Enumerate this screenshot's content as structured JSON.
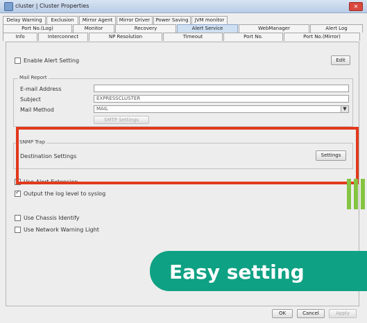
{
  "window": {
    "title": "cluster | Cluster Properties",
    "close_glyph": "✕"
  },
  "tabs": {
    "row1": [
      "Delay Warning",
      "Exclusion",
      "Mirror Agent",
      "Mirror Driver",
      "Power Saving",
      "JVM monitor"
    ],
    "row2": [
      "Port No.(Log)",
      "Monitor",
      "Recovery",
      "Alert Service",
      "WebManager",
      "Alert Log"
    ],
    "row3": [
      "Info",
      "Interconnect",
      "NP Resolution",
      "Timeout",
      "Port No.",
      "Port No.(Mirror)"
    ],
    "active": "Alert Service"
  },
  "alert": {
    "enable_label": "Enable Alert Setting",
    "enable_checked": false,
    "edit_button": "Edit"
  },
  "mail_report": {
    "legend": "Mail Report",
    "email_label": "E-mail Address",
    "email_value": "",
    "subject_label": "Subject",
    "subject_value": "EXPRESSCLUSTER",
    "method_label": "Mail Method",
    "method_value": "MAIL",
    "smtp_button": "SMTP Settings"
  },
  "snmp": {
    "legend": "SNMP Trap",
    "dest_label": "Destination Settings",
    "settings_button": "Settings"
  },
  "checks": {
    "chassis_ext": "Use Alert Extension",
    "syslog": "Output the log level to syslog",
    "syslog_checked": true,
    "chassis_identify": "Use Chassis Identify",
    "network_light": "Use Network Warning Light"
  },
  "footer": {
    "ok": "OK",
    "cancel": "Cancel",
    "apply": "Apply"
  },
  "banner": {
    "text": "Easy setting"
  },
  "colors": {
    "highlight": "#e2391c",
    "banner": "#0fa183",
    "accent_bar": "#85c441"
  }
}
